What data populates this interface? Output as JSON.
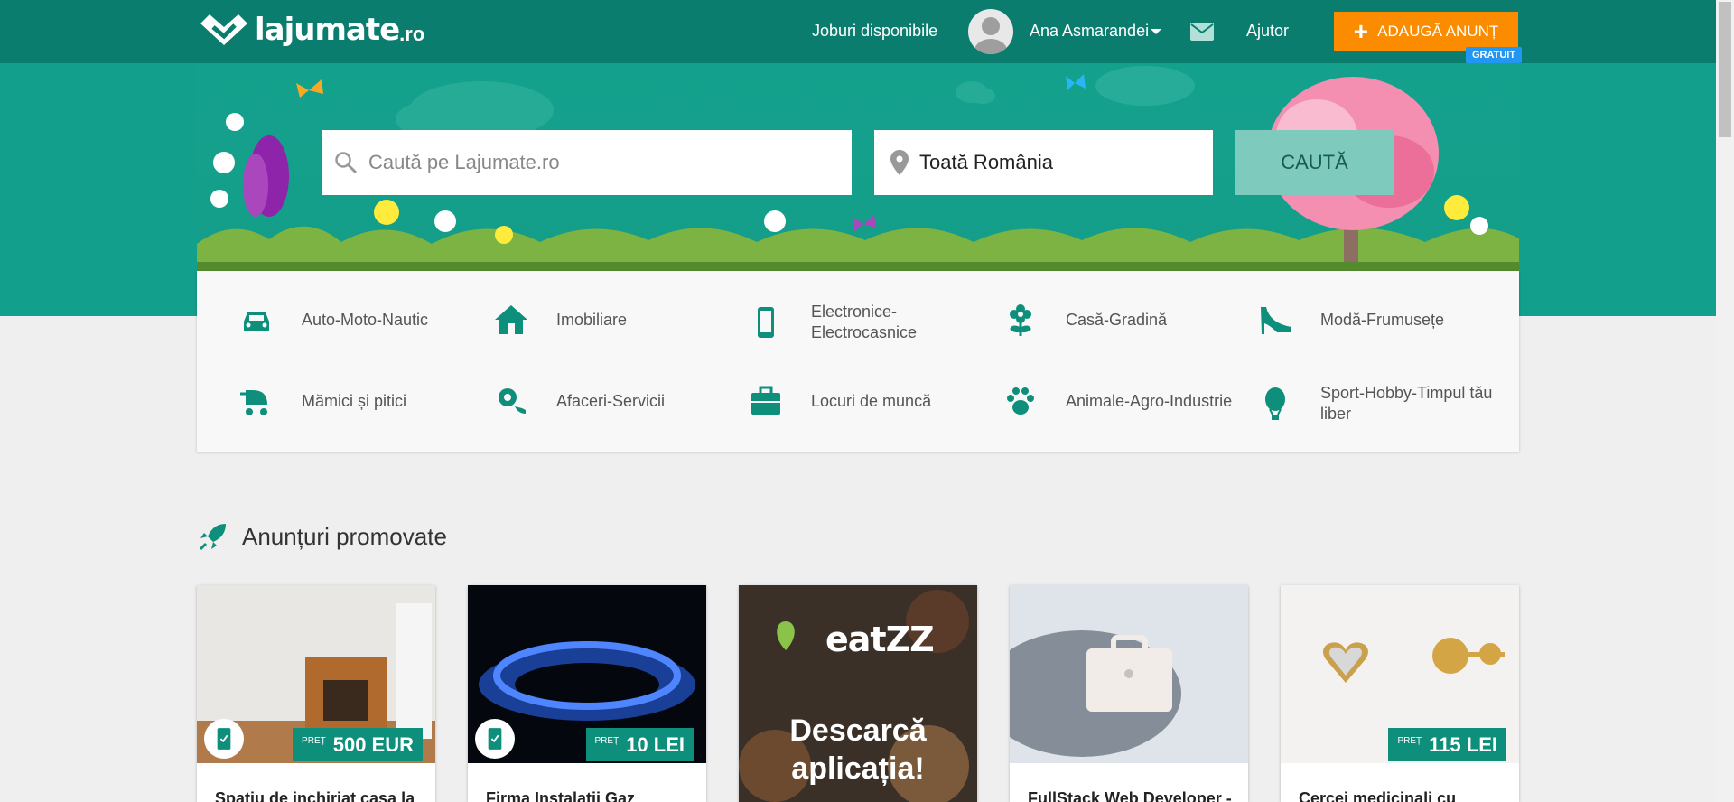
{
  "header": {
    "logo_text": "lajumate",
    "logo_tld": ".ro",
    "jobs_link": "Joburi disponibile",
    "user_name": "Ana Asmarandei",
    "help_link": "Ajutor",
    "add_button": "ADAUGĂ ANUNȚ",
    "free_badge": "GRATUIT"
  },
  "search": {
    "placeholder": "Caută pe Lajumate.ro",
    "location_value": "Toată România",
    "button_label": "CAUTĂ"
  },
  "categories": [
    {
      "label": "Auto-Moto-Nautic",
      "icon": "car-icon"
    },
    {
      "label": "Imobiliare",
      "icon": "house-icon"
    },
    {
      "label": "Electronice-Electrocasnice",
      "icon": "phone-icon"
    },
    {
      "label": "Casă-Gradină",
      "icon": "flower-icon"
    },
    {
      "label": "Modă-Frumusețe",
      "icon": "heel-shoe-icon"
    },
    {
      "label": "Mămici și pitici",
      "icon": "stroller-icon"
    },
    {
      "label": "Afaceri-Servicii",
      "icon": "gear-phone-icon"
    },
    {
      "label": "Locuri de muncă",
      "icon": "briefcase-icon"
    },
    {
      "label": "Animale-Agro-Industrie",
      "icon": "paw-icon"
    },
    {
      "label": "Sport-Hobby-Timpul tău liber",
      "icon": "hot-air-balloon-icon"
    }
  ],
  "promoted": {
    "title": "Anunțuri promovate",
    "cards": [
      {
        "title": "Spatiu de inchiriat casa la",
        "price_label": "PREȚ",
        "price": "500 EUR"
      },
      {
        "title": "Firma Instalatii Gaz",
        "price_label": "PREȚ",
        "price": "10 LEI"
      },
      {
        "title": "",
        "brand": "eatZZ",
        "promo_line1": "Descarcă",
        "promo_line2": "aplicația!"
      },
      {
        "title": "FullStack Web Developer -",
        "price_label": "",
        "price": ""
      },
      {
        "title": "Cercei medicinali cu",
        "price_label": "PREȚ",
        "price": "115 LEI"
      }
    ]
  },
  "colors": {
    "brand": "#0a7d6e",
    "accent": "#fb8c00",
    "badge": "#2196f3",
    "search_button": "#7ecbbe"
  }
}
